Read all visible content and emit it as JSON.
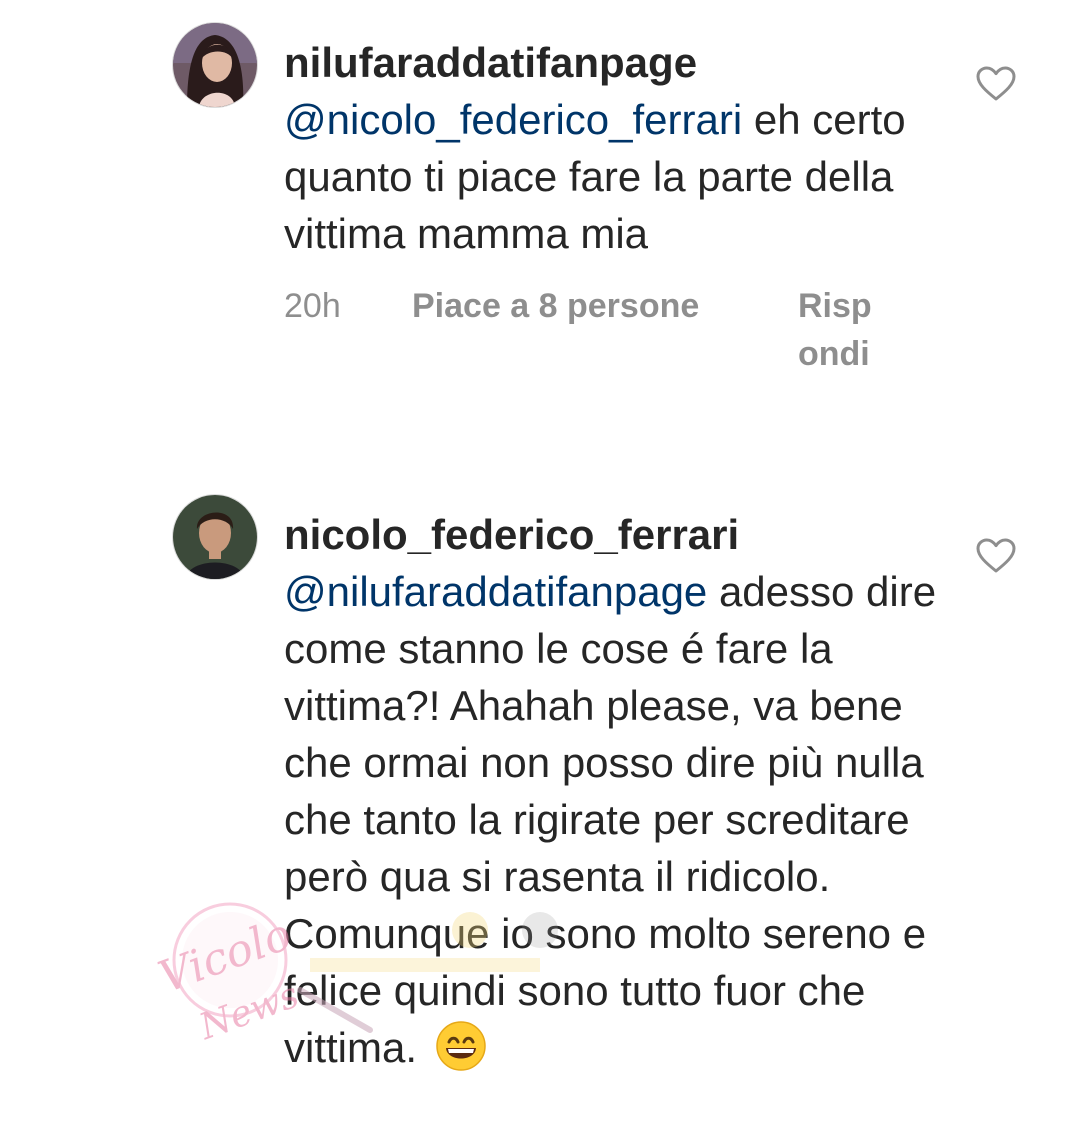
{
  "comments": [
    {
      "username": "nilufaraddatifanpage",
      "mention": "@nicolo_federico_ferrari",
      "text": "eh certo quanto ti piace fare la parte della vittima mamma mia",
      "time": "20h",
      "likes": "Piace a 8 persone",
      "reply": "Rispondi",
      "avatar_icon": "profile-photo-woman",
      "like_icon": "heart-outline-icon"
    },
    {
      "username": "nicolo_federico_ferrari",
      "mention": "@nilufaraddatifanpage",
      "text": "adesso dire come stanno le cose é fare la vittima?! Ahahah please, va bene che ormai non posso dire più nulla che tanto la rigirate per screditare però qua si rasenta il ridicolo. Comunque io sono molto sereno e felice quindi sono tutto fuor che vittima.",
      "emoji": "grinning-face-with-smiling-eyes",
      "avatar_icon": "profile-photo-man",
      "like_icon": "heart-outline-icon"
    }
  ],
  "colors": {
    "text": "#262626",
    "mention": "#003569",
    "meta": "#8e8e8e",
    "watermark": "#e87fa6"
  }
}
